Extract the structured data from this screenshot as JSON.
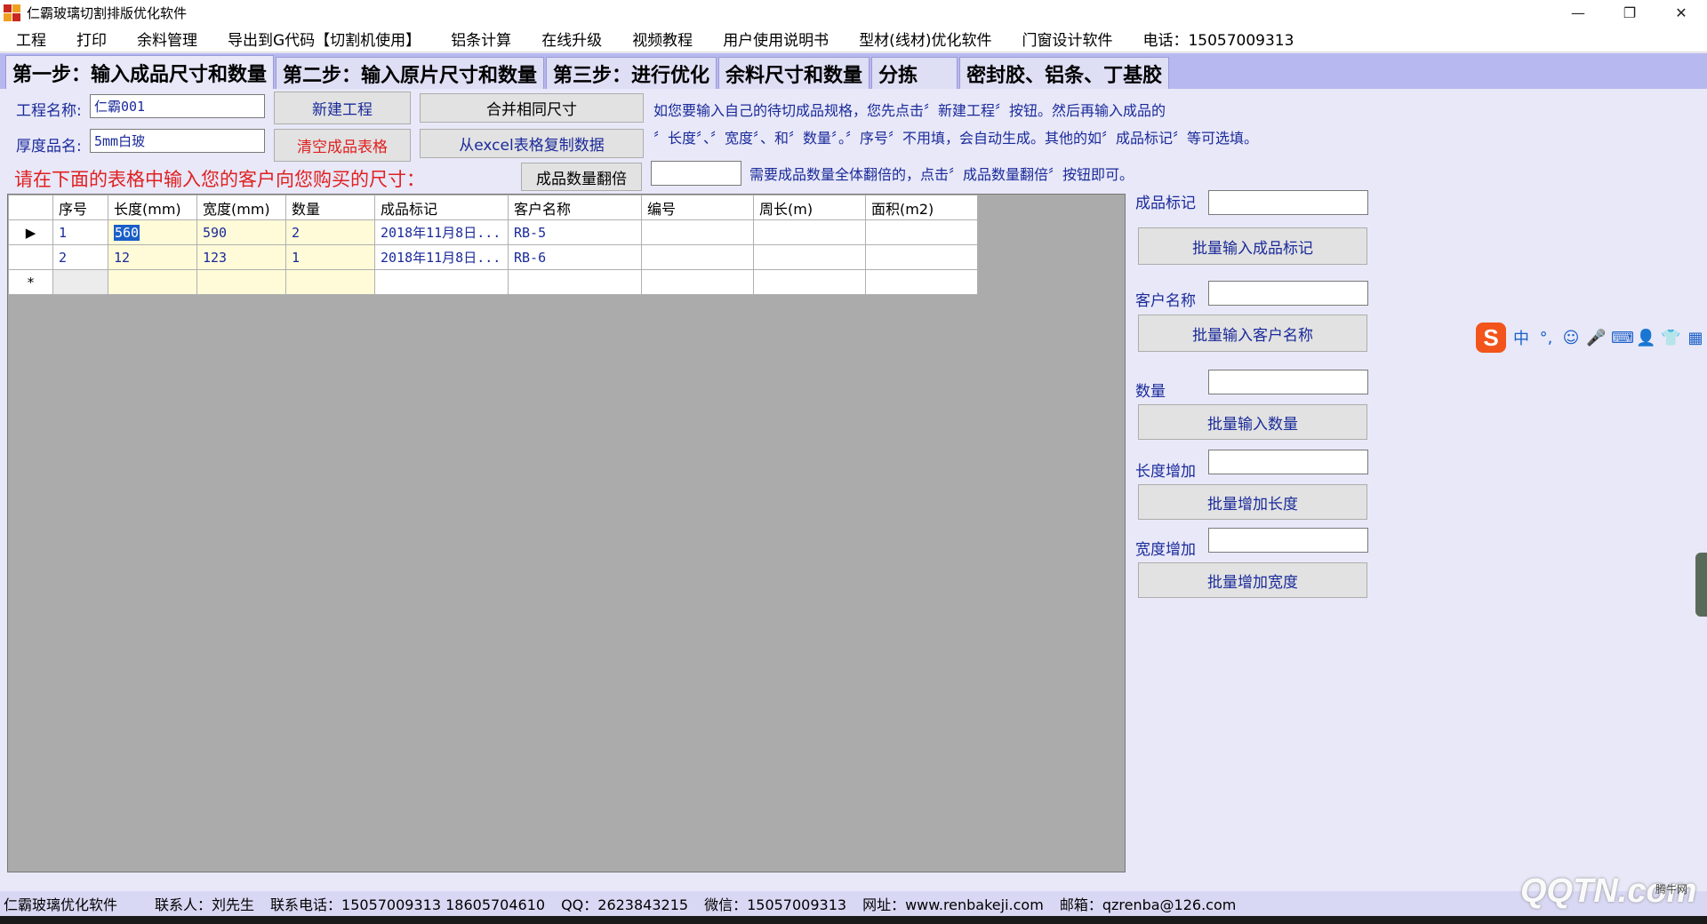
{
  "window": {
    "title": "仁霸玻璃切割排版优化软件",
    "minimize": "—",
    "restore": "❐",
    "close": "✕"
  },
  "menu": [
    "工程",
    "打印",
    "余料管理",
    "导出到G代码【切割机使用】",
    "铝条计算",
    "在线升级",
    "视频教程",
    "用户使用说明书",
    "型材(线材)优化软件",
    "门窗设计软件",
    "电话：15057009313"
  ],
  "tabs": [
    "第一步：输入成品尺寸和数量",
    "第二步：输入原片尺寸和数量",
    "第三步：进行优化",
    "余料尺寸和数量",
    "分拣",
    "密封胶、铝条、丁基胶"
  ],
  "form": {
    "project_label": "工程名称:",
    "project_value": "仁霸001",
    "thickness_label": "厚度品名:",
    "thickness_value": "5mm白玻",
    "new_project": "新建工程",
    "clear_table": "清空成品表格",
    "merge_sizes": "合并相同尺寸",
    "copy_excel": "从excel表格复制数据",
    "double_qty": "成品数量翻倍",
    "double_qty_value": "",
    "info_line1": "如您要输入自己的待切成品规格，您先点击〞新建工程〞按钮。然后再输入成品的",
    "info_line2": "〞长度〞、〞宽度〞、和〞数量〞。〞序号〞不用填，会自动生成。其他的如〞成品标记〞等可选填。",
    "info_line3": "需要成品数量全体翻倍的，点击〞成品数量翻倍〞按钮即可。",
    "prompt": "请在下面的表格中输入您的客户向您购买的尺寸："
  },
  "grid": {
    "headers": [
      "序号",
      "长度(mm)",
      "宽度(mm)",
      "数量",
      "成品标记",
      "客户名称",
      "编号",
      "周长(m)",
      "面积(m2)"
    ],
    "rows": [
      {
        "indicator": "▶",
        "cells": [
          "1",
          "560",
          "590",
          "2",
          "2018年11月8日...",
          "RB-5",
          "",
          "",
          ""
        ]
      },
      {
        "indicator": "",
        "cells": [
          "2",
          "12",
          "123",
          "1",
          "2018年11月8日...",
          "RB-6",
          "",
          "",
          ""
        ]
      }
    ],
    "new_row_indicator": "*"
  },
  "panel": {
    "mark_label": "成品标记",
    "mark_button": "批量输入成品标记",
    "customer_label": "客户名称",
    "customer_button": "批量输入客户名称",
    "qty_label": "数量",
    "qty_button": "批量输入数量",
    "len_label": "长度增加",
    "len_button": "批量增加长度",
    "wid_label": "宽度增加",
    "wid_button": "批量增加宽度"
  },
  "ime": {
    "logo": "S",
    "items": [
      "中",
      "°,",
      "☺",
      "🎤",
      "⌨",
      "👤",
      "👕",
      "▦"
    ]
  },
  "status": [
    "仁霸玻璃优化软件",
    "联系人：刘先生",
    "联系电话：15057009313 18605704610",
    "QQ：2623843215",
    "微信：15057009313",
    "网址：www.renbakeji.com",
    "邮箱：qzrenba@126.com"
  ],
  "watermark": {
    "main": "QQTN.com",
    "small": "腾牛网"
  },
  "colors": {
    "tab_bg": "#b8b8f0",
    "grid_bg": "#ababab",
    "text_blue": "#1a2a9a",
    "text_red": "#e02020",
    "selection": "#1a5fc8"
  }
}
